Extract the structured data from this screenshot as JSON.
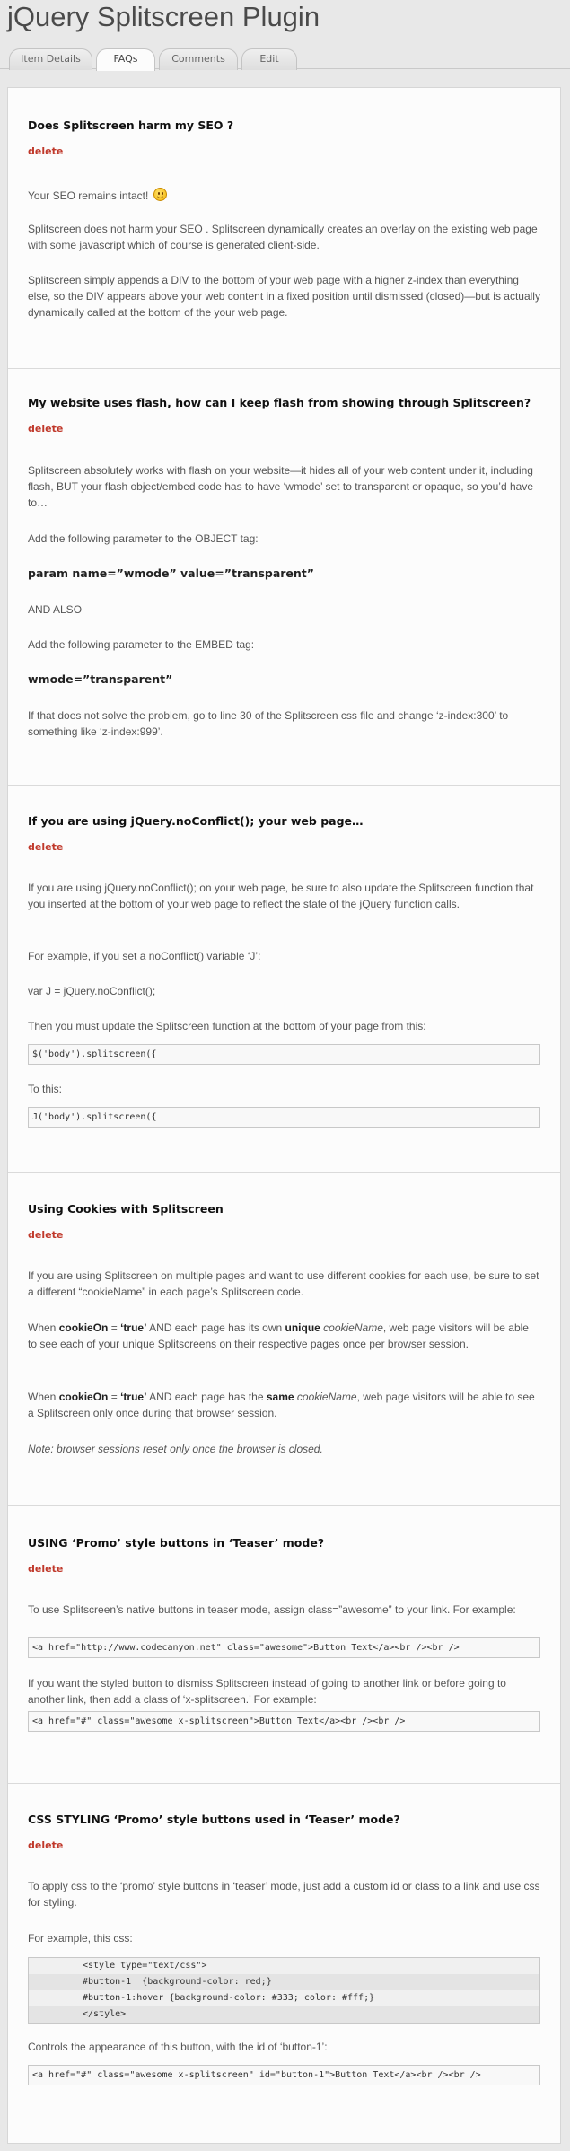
{
  "page": {
    "title": "jQuery Splitscreen Plugin"
  },
  "tabs": [
    {
      "label": "Item Details"
    },
    {
      "label": "FAQs"
    },
    {
      "label": "Comments"
    },
    {
      "label": "Edit"
    }
  ],
  "delete_label": "delete",
  "faqs": [
    {
      "question": "Does Splitscreen harm my SEO ?",
      "p1": "Your SEO remains intact!",
      "p2": "Splitscreen does not harm your SEO . Splitscreen dynamically creates an overlay on the existing web page with some javascript which of course is generated client-side.",
      "p3": "Splitscreen simply appends a DIV to the bottom of your web page with a higher z-index than everything else, so the DIV appears above your web content in a fixed position until dismissed (closed)—but is actually dynamically called at the bottom of the your web page."
    },
    {
      "question": "My website uses flash, how can I keep flash from showing through Splitscreen?",
      "p1": "Splitscreen absolutely works with flash on your website—it hides all of your web content under it, including flash, BUT your flash object/embed code has to have ‘wmode’ set to transparent or opaque, so you’d have to…",
      "p2": "Add the following parameter to the OBJECT tag:",
      "p3": "param name=”wmode” value=”transparent”",
      "p4": "AND ALSO",
      "p5": "Add the following parameter to the EMBED tag:",
      "p6": "wmode=”transparent”",
      "p7": "If that does not solve the problem, go to line 30 of the Splitscreen css file and change ‘z-index:300’ to something like ‘z-index:999’."
    },
    {
      "question": "If you are using jQuery.noConflict(); your web page…",
      "p1": "If you are using jQuery.noConflict(); on your web page, be sure to also update the Splitscreen function that you inserted at the bottom of your web page to reflect the state of the jQuery function calls.",
      "p2": "For example, if you set a noConflict() variable ‘J’:",
      "p3": "var J = jQuery.noConflict();",
      "p4": "Then you must update the Splitscreen function at the bottom of your page from this:",
      "code1": "$('body').splitscreen({",
      "p5": "To this:",
      "code2": "J('body').splitscreen({"
    },
    {
      "question": "Using Cookies with Splitscreen",
      "p1": "If you are using Splitscreen on multiple pages and want to use different cookies for each use, be sure to set a different “cookieName” in each page’s Splitscreen code.",
      "p2a": "When ",
      "p2b": "cookieOn",
      "p2c": " = ",
      "p2d": "‘true’",
      "p2e": " AND each page has its own ",
      "p2f": "unique",
      "p2g": " ",
      "p2h": "cookieName",
      "p2i": ", web page visitors will be able to see each of your unique Splitscreens on their respective pages once per browser session.",
      "p3a": "When ",
      "p3b": "cookieOn",
      "p3c": " = ",
      "p3d": "‘true’",
      "p3e": " AND each page has the ",
      "p3f": "same",
      "p3g": " ",
      "p3h": "cookieName",
      "p3i": ", web page visitors will be able to see a Splitscreen only once during that browser session.",
      "p4": "Note: browser sessions reset only once the browser is closed."
    },
    {
      "question": "USING ‘Promo’ style buttons in ‘Teaser’ mode?",
      "p1": "To use Splitscreen’s native buttons in teaser mode, assign class=”awesome” to your link. For example:",
      "code1": "<a href=\"http://www.codecanyon.net\" class=\"awesome\">Button Text</a><br /><br />",
      "p2": "If you want the styled button to dismiss Splitscreen instead of going to another link or before going to another link, then add a class of ‘x-splitscreen.’ For example:",
      "code2": "<a href=\"#\" class=\"awesome x-splitscreen\">Button Text</a><br /><br />"
    },
    {
      "question": "CSS STYLING ‘Promo’ style buttons used in ‘Teaser’ mode?",
      "p1": "To apply css to the ‘promo’ style buttons in ‘teaser’ mode, just add a custom id or class to a link and use css for styling.",
      "p2": "For example, this css:",
      "css_lines": [
        "<style type=\"text/css\">",
        "#button-1  {background-color: red;}",
        "#button-1:hover {background-color: #333; color: #fff;}",
        "</style>"
      ],
      "p3": "Controls the appearance of this button, with the id of ‘button-1’:",
      "code1": "<a href=\"#\" class=\"awesome x-splitscreen\" id=\"button-1\">Button Text</a><br /><br />"
    }
  ]
}
